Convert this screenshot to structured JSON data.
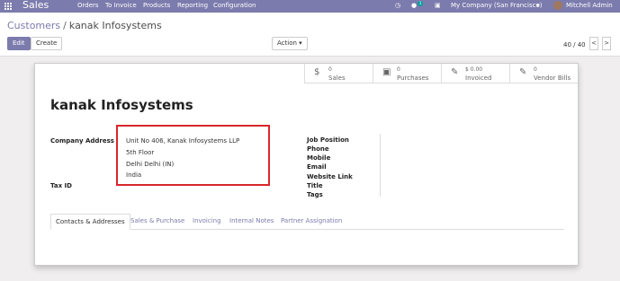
{
  "navbar": {
    "app_name": "Sales",
    "menu": [
      "Orders",
      "To Invoice",
      "Products",
      "Reporting",
      "Configuration"
    ],
    "message_count": "3",
    "company": "My Company (San Francisco)",
    "user": "Mitchell Admin",
    "icons": [
      "apps-grid-icon",
      "clock-icon",
      "chat-icon",
      "gift-icon",
      "caret-down-icon"
    ]
  },
  "breadcrumb": {
    "parent": "Customers",
    "separator": "/",
    "current": "kanak Infosystems"
  },
  "buttons": {
    "edit": "Edit",
    "create": "Create",
    "action": "Action"
  },
  "pager": {
    "value": "40 / 40",
    "prev": "<",
    "next": ">"
  },
  "stats": [
    {
      "value": "0",
      "label": "Sales",
      "icon": "dollar-icon"
    },
    {
      "value": "0",
      "label": "Purchases",
      "icon": "cart-icon"
    },
    {
      "value": "$ 0.00",
      "label": "Invoiced",
      "icon": "edit-icon"
    },
    {
      "value": "0",
      "label": "Vendor Bills",
      "icon": "edit-icon"
    }
  ],
  "partner": {
    "name": "kanak Infosystems",
    "address_label": "Company Address",
    "address_lines": [
      "Unit No 406, Kanak Infosystems LLP",
      "5th Floor",
      "Delhi  Delhi (IN)",
      "India"
    ],
    "tax_label": "Tax ID",
    "right_labels": [
      "Job Position",
      "Phone",
      "Mobile",
      "Email",
      "Website Link",
      "Title",
      "Tags"
    ]
  },
  "tabs": [
    "Contacts & Addresses",
    "Sales & Purchase",
    "Invoicing",
    "Internal Notes",
    "Partner Assignation"
  ],
  "colors": {
    "navbar": "#7c7bad",
    "highlight": "#d9262b",
    "badge": "#00a09d"
  }
}
